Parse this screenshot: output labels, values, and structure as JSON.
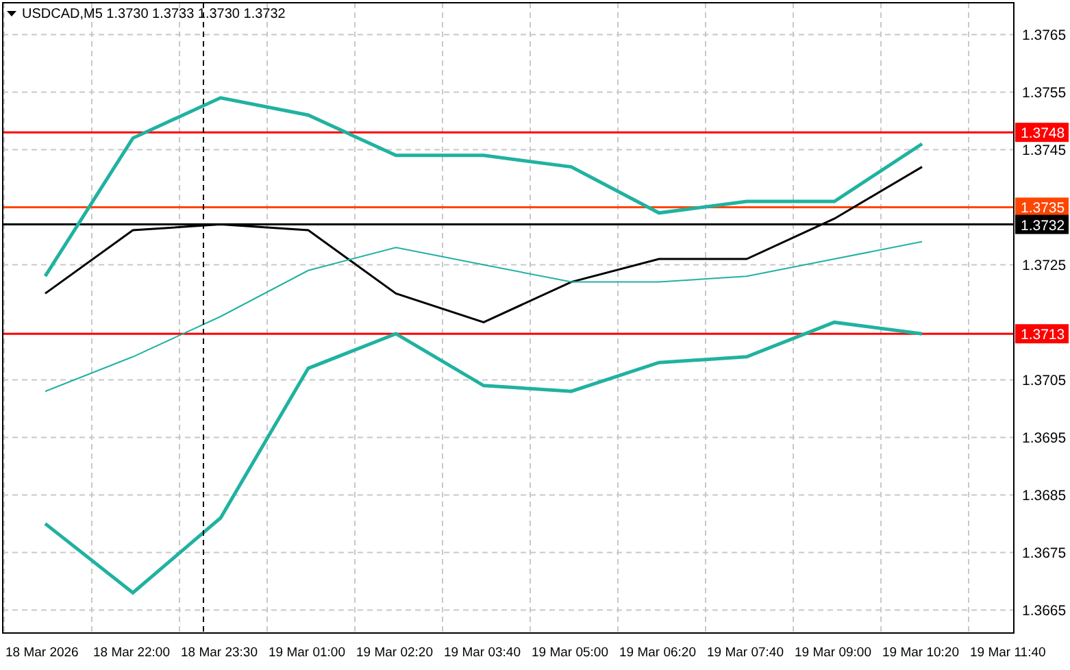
{
  "chart": {
    "title": "USDCAD,M5  1.3730 1.3733 1.3730 1.3732",
    "chart_data": {
      "type": "line",
      "categories": [
        "18 Mar 2026",
        "18 Mar 22:00",
        "18 Mar 23:30",
        "19 Mar 01:00",
        "19 Mar 02:20",
        "19 Mar 03:40",
        "19 Mar 05:00",
        "19 Mar 06:20",
        "19 Mar 07:40",
        "19 Mar 09:00",
        "19 Mar 10:20",
        "19 Mar 11:40"
      ],
      "series": [
        {
          "color": "#000000",
          "values": [
            1.372,
            1.3731,
            1.3732,
            1.3731,
            1.372,
            1.3715,
            1.3722,
            1.3726,
            1.3726,
            1.3733,
            1.3742,
            null
          ]
        },
        {
          "color": "#20b2a0",
          "values": [
            1.3723,
            1.3747,
            1.3754,
            1.3751,
            1.3744,
            1.3744,
            1.3742,
            1.3734,
            1.3736,
            1.3736,
            1.3746,
            null
          ]
        },
        {
          "color": "#20b2a0",
          "values": [
            1.3703,
            1.3709,
            1.3716,
            1.3724,
            1.3728,
            1.3725,
            1.3722,
            1.3722,
            1.3723,
            1.3726,
            1.3729,
            null
          ]
        },
        {
          "color": "#20b2a0",
          "values": [
            1.368,
            1.3668,
            1.3681,
            1.3707,
            1.3713,
            1.3704,
            1.3703,
            1.3708,
            1.3709,
            1.3715,
            1.3713,
            null
          ]
        }
      ],
      "ylim": [
        1.3661,
        1.3771
      ],
      "grid": true,
      "yticks": [
        {
          "value": 1.3765,
          "label": "1.3765"
        },
        {
          "value": 1.3755,
          "label": "1.3755"
        },
        {
          "value": 1.3745,
          "label": "1.3745"
        },
        {
          "value": 1.3725,
          "label": "1.3725"
        },
        {
          "value": 1.3705,
          "label": "1.3705"
        },
        {
          "value": 1.3695,
          "label": "1.3695"
        },
        {
          "value": 1.3685,
          "label": "1.3685"
        },
        {
          "value": 1.3675,
          "label": "1.3675"
        },
        {
          "value": 1.3665,
          "label": "1.3665"
        }
      ],
      "ref_lines": [
        {
          "axis": "y",
          "value": 1.3748,
          "label": "1.3748",
          "color": "#ff0000"
        },
        {
          "axis": "y",
          "value": 1.3735,
          "label": "1.3735",
          "color": "#ff4500"
        },
        {
          "axis": "y",
          "value": 1.3732,
          "label": "1.3732",
          "color": "#000000"
        },
        {
          "axis": "y",
          "value": 1.3713,
          "label": "1.3713",
          "color": "#ff0000"
        }
      ]
    }
  }
}
